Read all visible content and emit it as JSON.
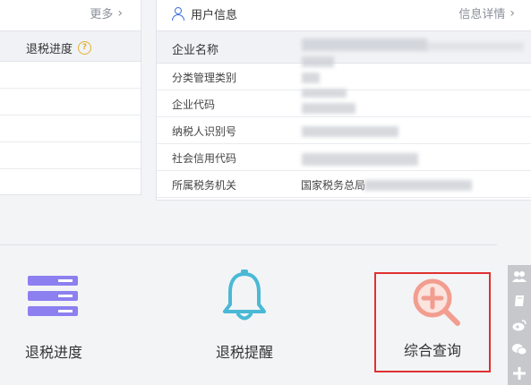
{
  "left_panel": {
    "more_label": "更多",
    "column_header": "退税进度",
    "empty_rows": 4
  },
  "right_panel": {
    "title": "用户信息",
    "detail_link": "信息详情",
    "rows": [
      {
        "label": "企业名称",
        "value": ""
      },
      {
        "label": "分类管理类别",
        "value": ""
      },
      {
        "label": "企业代码",
        "value": ""
      },
      {
        "label": "纳税人识别号",
        "value": ""
      },
      {
        "label": "社会信用代码",
        "value": ""
      },
      {
        "label": "所属税务机关",
        "value": "国家税务总局"
      }
    ]
  },
  "functions": [
    {
      "label": "退税进度",
      "icon": "list-icon",
      "selected": false
    },
    {
      "label": "退税提醒",
      "icon": "bell-icon",
      "selected": false
    },
    {
      "label": "综合查询",
      "icon": "zoom-in-icon",
      "selected": true
    }
  ],
  "side_toolbar": [
    "group-icon",
    "book-icon",
    "weibo-icon",
    "wechat-icon",
    "plus-icon"
  ],
  "colors": {
    "accent": "#3d6fe0",
    "highlight_border": "#e03131",
    "list_icon": "#8c7ff0",
    "bell_icon": "#49b9d6",
    "zoom_icon": "#f29d8f"
  }
}
